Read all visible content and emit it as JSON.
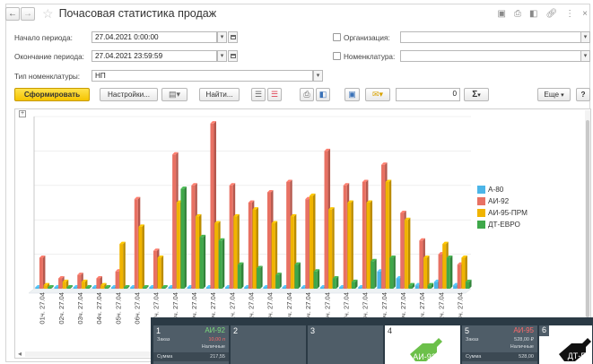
{
  "window": {
    "title": "Почасовая статистика продаж"
  },
  "form": {
    "period_start_label": "Начало периода:",
    "period_start_value": "27.04.2021  0:00:00",
    "period_end_label": "Окончание периода:",
    "period_end_value": "27.04.2021 23:59:59",
    "organization_label": "Организация:",
    "nomenclature_label": "Номенклатура:",
    "nom_type_label": "Тип номенклатуры:",
    "nom_type_value": "НП"
  },
  "toolbar": {
    "generate_label": "Сформировать",
    "settings_label": "Настройки...",
    "find_label": "Найти...",
    "number_value": "0",
    "sum_label": "Σ",
    "more_label": "Еще",
    "help_label": "?"
  },
  "chart_data": {
    "type": "bar",
    "categories": [
      "01ч. 27.04",
      "02ч. 27.04",
      "03ч. 27.04",
      "04ч. 27.04",
      "05ч. 27.04",
      "06ч. 27.04",
      "07ч. 27.04",
      "08ч. 27.04",
      "09ч. 27.04",
      "10ч. 27.04",
      "11ч. 27.04",
      "12ч. 27.04",
      "13ч. 27.04",
      "14ч. 27.04",
      "15ч. 27.04",
      "16ч. 27.04",
      "17ч. 27.04",
      "18ч. 27.04",
      "19ч. 27.04",
      "20ч. 27.04",
      "21ч. 27.04",
      "22ч. 27.04",
      "23ч. 27.04"
    ],
    "tick_labels": [
      "01ч. 27.04",
      "02ч. 27.04",
      "03ч. 27.04",
      "04ч. 27.04",
      "05ч. 27.04",
      "06ч. 27.04",
      "07ч. 27.04",
      "08ч. 27.04",
      "09ч. 27.04",
      "10ч. 27.04",
      "11ч. 27.04",
      "12ч. 27.04",
      "13ч. 27.04",
      "14ч. 27.04",
      "15ч. 27.04",
      "16ч. 27.04",
      "17ч. 27.04",
      "18ч. 27.04",
      "19ч. 27.04",
      "20ч. 27.04",
      "21ч. 27.04",
      "22ч. 27.04",
      "23ч. 27.04"
    ],
    "series": [
      {
        "name": "А-80",
        "color": "#4cb5e8",
        "values": [
          0,
          0,
          0,
          0,
          0,
          0,
          0,
          0,
          0,
          0,
          0,
          0,
          0,
          0,
          0,
          0,
          0,
          0,
          10,
          6,
          2,
          4,
          2
        ]
      },
      {
        "name": "АИ-92",
        "color": "#e87163",
        "values": [
          18,
          6,
          8,
          6,
          10,
          52,
          22,
          78,
          60,
          96,
          60,
          50,
          56,
          62,
          52,
          80,
          60,
          62,
          72,
          44,
          28,
          20,
          14
        ]
      },
      {
        "name": "АИ-95-ПРМ",
        "color": "#f0b400",
        "values": [
          2,
          4,
          4,
          2,
          26,
          36,
          18,
          50,
          42,
          38,
          42,
          46,
          38,
          42,
          54,
          46,
          50,
          50,
          62,
          40,
          18,
          26,
          18
        ]
      },
      {
        "name": "ДТ-ЕВРО",
        "color": "#3fa84a",
        "values": [
          0,
          0,
          0,
          0,
          0,
          0,
          0,
          58,
          30,
          28,
          14,
          12,
          8,
          14,
          10,
          6,
          4,
          16,
          18,
          2,
          2,
          18,
          4
        ]
      }
    ]
  },
  "pumps": [
    {
      "num": "1",
      "fuel": "АИ-92",
      "fuel_color": "#ff6a6a",
      "order_label": "Заказ",
      "order_value": "10,00 л",
      "pay_label": "Наличные",
      "sum_label": "Сумма",
      "sum_value": "217,55"
    },
    {
      "num": "2"
    },
    {
      "num": "3"
    },
    {
      "num": "4",
      "badge": "АИ-92"
    },
    {
      "num": "5",
      "fuel": "АИ-95",
      "fuel_color": "#ff6a6a",
      "order_label": "Заказ",
      "order_value": "528,00 ₽",
      "pay_label": "Наличные",
      "sum_label": "Сумма",
      "sum_value": "528,00"
    },
    {
      "num": "6",
      "badge": "ДТ-Е"
    }
  ]
}
